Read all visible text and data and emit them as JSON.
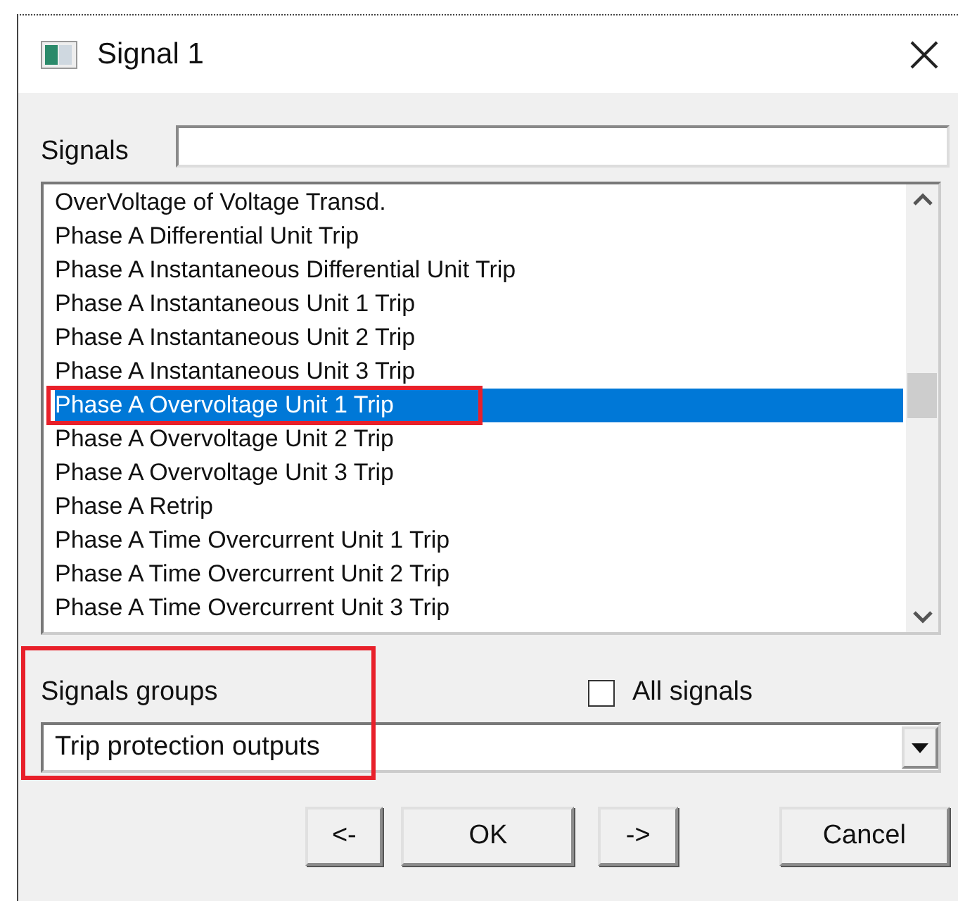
{
  "window": {
    "title": "Signal 1"
  },
  "signals_filter": {
    "label": "Signals"
  },
  "signals": [
    {
      "label": "OverVoltage of Voltage Transd.",
      "selected": false,
      "marked": false
    },
    {
      "label": "Phase A Differential Unit Trip",
      "selected": false,
      "marked": false
    },
    {
      "label": "Phase A Instantaneous Differential Unit Trip",
      "selected": false,
      "marked": false
    },
    {
      "label": "Phase A Instantaneous Unit 1 Trip",
      "selected": false,
      "marked": false
    },
    {
      "label": "Phase A Instantaneous Unit 2 Trip",
      "selected": false,
      "marked": false
    },
    {
      "label": "Phase A Instantaneous Unit 3 Trip",
      "selected": false,
      "marked": false
    },
    {
      "label": "Phase A Overvoltage Unit 1 Trip",
      "selected": true,
      "marked": true
    },
    {
      "label": "Phase A Overvoltage Unit 2 Trip",
      "selected": false,
      "marked": false
    },
    {
      "label": "Phase A Overvoltage Unit 3 Trip",
      "selected": false,
      "marked": false
    },
    {
      "label": "Phase A Retrip",
      "selected": false,
      "marked": false
    },
    {
      "label": "Phase A Time Overcurrent Unit 1 Trip",
      "selected": false,
      "marked": false
    },
    {
      "label": "Phase A Time Overcurrent Unit 2 Trip",
      "selected": false,
      "marked": false
    },
    {
      "label": "Phase A Time Overcurrent Unit 3 Trip",
      "selected": false,
      "marked": false
    }
  ],
  "signals_groups": {
    "label": "Signals groups",
    "value": "Trip protection outputs",
    "marked": true
  },
  "all_signals": {
    "label": "All signals",
    "checked": false
  },
  "buttons": [
    "<-",
    "OK",
    "->",
    "Cancel"
  ]
}
